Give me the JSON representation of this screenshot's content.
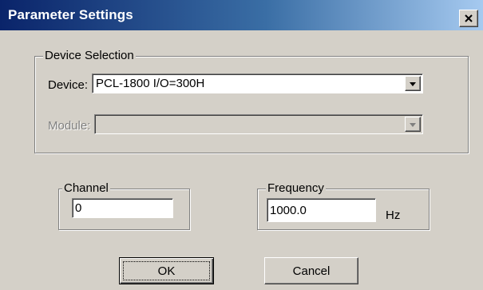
{
  "window": {
    "title": "Parameter Settings",
    "close_icon": "close-icon"
  },
  "device_selection": {
    "group_label": "Device Selection",
    "device_label": "Device:",
    "device_value": "PCL-1800 I/O=300H",
    "module_label": "Module:",
    "module_value": "",
    "module_enabled": false
  },
  "channel": {
    "group_label": "Channel",
    "value": "0"
  },
  "frequency": {
    "group_label": "Frequency",
    "value": "1000.0",
    "unit": "Hz"
  },
  "buttons": {
    "ok_label": "OK",
    "cancel_label": "Cancel"
  }
}
